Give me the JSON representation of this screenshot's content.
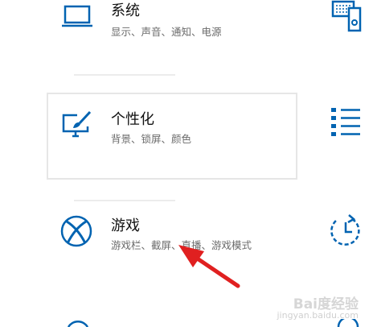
{
  "tiles": {
    "system": {
      "title": "系统",
      "desc": "显示、声音、通知、电源",
      "icon": "laptop-icon"
    },
    "personalization": {
      "title": "个性化",
      "desc": "背景、锁屏、颜色",
      "icon": "paintbrush-monitor-icon"
    },
    "gaming": {
      "title": "游戏",
      "desc": "游戏栏、截屏、直播、游戏模式",
      "icon": "xbox-icon"
    }
  },
  "right_column_icons": [
    "keyboard-phone-icon",
    "list-icon",
    "clock-arrow-icon"
  ],
  "watermark": {
    "brand": "Bai度经验",
    "url": "jingyan.baidu.com"
  },
  "colors": {
    "accent": "#0063b1",
    "arrow": "#e02020",
    "tile_border": "#e6e6e6",
    "desc_text": "#6b6b6b"
  }
}
